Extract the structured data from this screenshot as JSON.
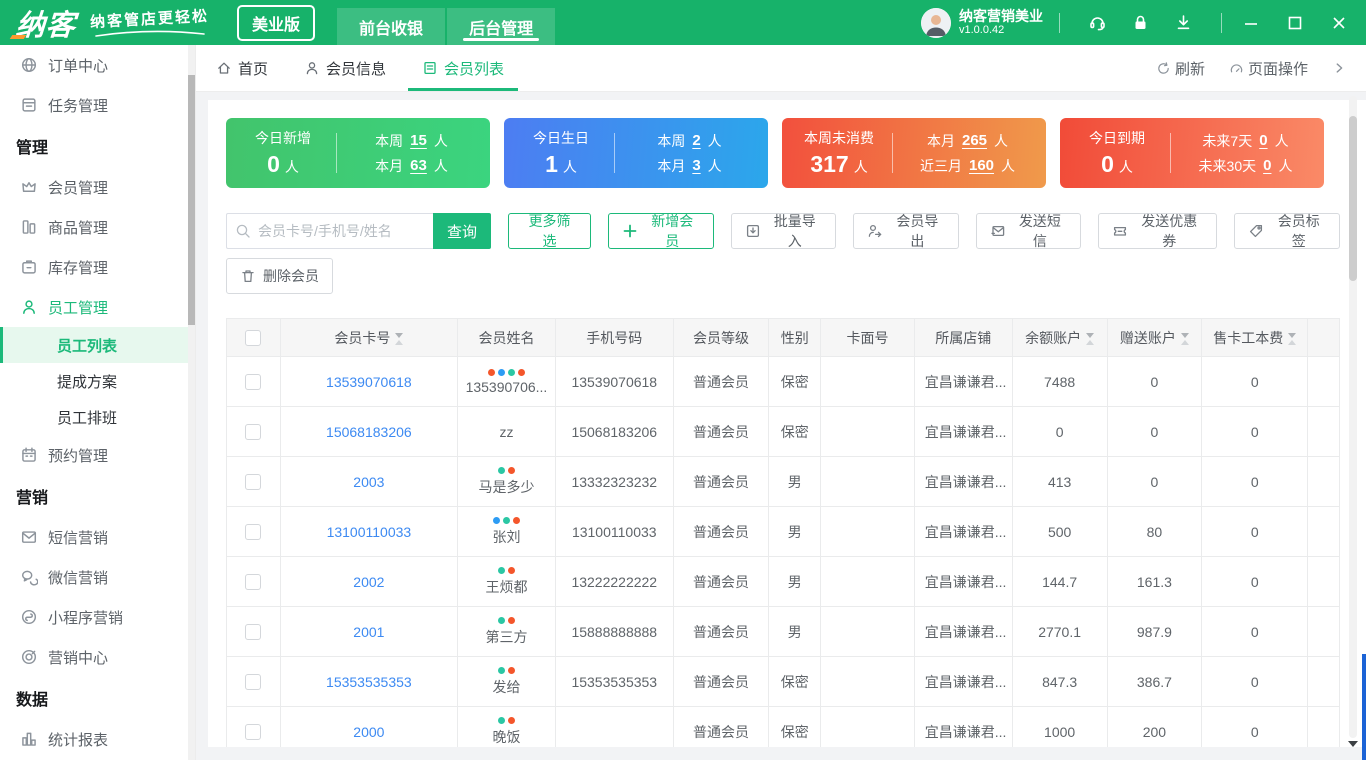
{
  "header": {
    "brand": "纳客",
    "tagline": "纳客管店更轻松",
    "edition": "美业版",
    "nav": [
      {
        "label": "前台收银",
        "active": false
      },
      {
        "label": "后台管理",
        "active": true
      }
    ],
    "user": {
      "name": "纳客营销美业",
      "version": "v1.0.0.42"
    },
    "action_icons": [
      "headset",
      "lock",
      "download"
    ],
    "window_controls": [
      "minimize",
      "maximize",
      "close"
    ]
  },
  "sidebar": {
    "items": [
      {
        "type": "item",
        "icon": "globe",
        "label": "订单中心",
        "chevron": "right"
      },
      {
        "type": "item",
        "icon": "task",
        "label": "任务管理"
      },
      {
        "type": "section",
        "label": "管理"
      },
      {
        "type": "item",
        "icon": "crown",
        "label": "会员管理",
        "chevron": "right"
      },
      {
        "type": "item",
        "icon": "goods",
        "label": "商品管理",
        "chevron": "right"
      },
      {
        "type": "item",
        "icon": "stock",
        "label": "库存管理",
        "chevron": "right"
      },
      {
        "type": "item",
        "icon": "person",
        "label": "员工管理",
        "chevron": "down",
        "active": true
      },
      {
        "type": "subitem",
        "label": "员工列表",
        "active": true
      },
      {
        "type": "subitem",
        "label": "提成方案"
      },
      {
        "type": "subitem",
        "label": "员工排班"
      },
      {
        "type": "item",
        "icon": "calendar",
        "label": "预约管理"
      },
      {
        "type": "section",
        "label": "营销"
      },
      {
        "type": "item",
        "icon": "mail",
        "label": "短信营销"
      },
      {
        "type": "item",
        "icon": "wechat",
        "label": "微信营销"
      },
      {
        "type": "item",
        "icon": "miniapp",
        "label": "小程序营销"
      },
      {
        "type": "item",
        "icon": "target",
        "label": "营销中心"
      },
      {
        "type": "section",
        "label": "数据"
      },
      {
        "type": "item",
        "icon": "chart",
        "label": "统计报表",
        "chevron": "right"
      }
    ]
  },
  "tabbar": {
    "tabs": [
      {
        "icon": "home",
        "label": "首页",
        "active": false
      },
      {
        "icon": "user",
        "label": "会员信息",
        "active": false
      },
      {
        "icon": "list",
        "label": "会员列表",
        "active": true
      }
    ],
    "refresh": "刷新",
    "page_ops": "页面操作"
  },
  "stat_cards": [
    {
      "title": "今日新增",
      "value": "0",
      "unit": "人",
      "colors": [
        "#42c46c",
        "#3bd47f"
      ],
      "rows": [
        {
          "label": "本周",
          "value": "15",
          "unit": "人"
        },
        {
          "label": "本月",
          "value": "63",
          "unit": "人"
        }
      ]
    },
    {
      "title": "今日生日",
      "value": "1",
      "unit": "人",
      "colors": [
        "#4d7df2",
        "#2ba7eb"
      ],
      "rows": [
        {
          "label": "本周",
          "value": "2",
          "unit": "人"
        },
        {
          "label": "本月",
          "value": "3",
          "unit": "人"
        }
      ]
    },
    {
      "title": "本周未消费",
      "value": "317",
      "unit": "人",
      "colors": [
        "#f2503d",
        "#f09a4b"
      ],
      "rows": [
        {
          "label": "本月",
          "value": "265",
          "unit": "人"
        },
        {
          "label": "近三月",
          "value": "160",
          "unit": "人"
        }
      ]
    },
    {
      "title": "今日到期",
      "value": "0",
      "unit": "人",
      "colors": [
        "#f14b38",
        "#fa8a67"
      ],
      "rows": [
        {
          "label": "未来7天",
          "value": "0",
          "unit": "人"
        },
        {
          "label": "未来30天",
          "value": "0",
          "unit": "人"
        }
      ]
    }
  ],
  "toolbar": {
    "search_placeholder": "会员卡号/手机号/姓名",
    "search_button": "查询",
    "buttons_row1": [
      {
        "label": "更多筛选",
        "style": "green"
      },
      {
        "label": "新增会员",
        "style": "green",
        "icon": "plus"
      },
      {
        "label": "批量导入",
        "style": "gray",
        "icon": "import"
      },
      {
        "label": "会员导出",
        "style": "gray",
        "icon": "user-export"
      },
      {
        "label": "发送短信",
        "style": "gray",
        "icon": "mail-send"
      },
      {
        "label": "发送优惠券",
        "style": "gray",
        "icon": "coupon"
      },
      {
        "label": "会员标签",
        "style": "gray",
        "icon": "tag"
      }
    ],
    "buttons_row2": [
      {
        "label": "删除会员",
        "style": "gray",
        "icon": "trash"
      }
    ]
  },
  "table": {
    "columns": [
      {
        "key": "select",
        "label": "",
        "type": "checkbox"
      },
      {
        "key": "card_no",
        "label": "会员卡号",
        "sortable": true
      },
      {
        "key": "name",
        "label": "会员姓名"
      },
      {
        "key": "phone",
        "label": "手机号码"
      },
      {
        "key": "level",
        "label": "会员等级"
      },
      {
        "key": "gender",
        "label": "性别"
      },
      {
        "key": "card_face",
        "label": "卡面号"
      },
      {
        "key": "store",
        "label": "所属店铺"
      },
      {
        "key": "balance",
        "label": "余额账户",
        "sortable": true
      },
      {
        "key": "gift",
        "label": "赠送账户",
        "sortable": true
      },
      {
        "key": "card_fee",
        "label": "售卡工本费",
        "sortable": true
      },
      {
        "key": "extra",
        "label": ""
      }
    ],
    "rows": [
      {
        "card_no": "13539070618",
        "dots": [
          "orange",
          "blue",
          "teal",
          "orange"
        ],
        "name": "135390706...",
        "phone": "13539070618",
        "level": "普通会员",
        "gender": "保密",
        "card_face": "",
        "store": "宜昌谦谦君...",
        "balance": "7488",
        "gift": "0",
        "card_fee": "0"
      },
      {
        "card_no": "15068183206",
        "dots": [],
        "name": "zz",
        "phone": "15068183206",
        "level": "普通会员",
        "gender": "保密",
        "card_face": "",
        "store": "宜昌谦谦君...",
        "balance": "0",
        "gift": "0",
        "card_fee": "0"
      },
      {
        "card_no": "2003",
        "dots": [
          "teal",
          "orange"
        ],
        "name": "马是多少",
        "phone": "13332323232",
        "level": "普通会员",
        "gender": "男",
        "card_face": "",
        "store": "宜昌谦谦君...",
        "balance": "413",
        "gift": "0",
        "card_fee": "0"
      },
      {
        "card_no": "13100110033",
        "dots": [
          "blue",
          "teal",
          "orange"
        ],
        "name": "张刘",
        "phone": "13100110033",
        "level": "普通会员",
        "gender": "男",
        "card_face": "",
        "store": "宜昌谦谦君...",
        "balance": "500",
        "gift": "80",
        "card_fee": "0"
      },
      {
        "card_no": "2002",
        "dots": [
          "teal",
          "orange"
        ],
        "name": "王烦都",
        "phone": "13222222222",
        "level": "普通会员",
        "gender": "男",
        "card_face": "",
        "store": "宜昌谦谦君...",
        "balance": "144.7",
        "gift": "161.3",
        "card_fee": "0"
      },
      {
        "card_no": "2001",
        "dots": [
          "teal",
          "orange"
        ],
        "name": "第三方",
        "phone": "15888888888",
        "level": "普通会员",
        "gender": "男",
        "card_face": "",
        "store": "宜昌谦谦君...",
        "balance": "2770.1",
        "gift": "987.9",
        "card_fee": "0"
      },
      {
        "card_no": "15353535353",
        "dots": [
          "teal",
          "orange"
        ],
        "name": "发给",
        "phone": "15353535353",
        "level": "普通会员",
        "gender": "保密",
        "card_face": "",
        "store": "宜昌谦谦君...",
        "balance": "847.3",
        "gift": "386.7",
        "card_fee": "0"
      },
      {
        "card_no": "2000",
        "dots": [
          "teal",
          "orange"
        ],
        "name": "晚饭",
        "phone": "",
        "level": "普通会员",
        "gender": "保密",
        "card_face": "",
        "store": "宜昌谦谦君...",
        "balance": "1000",
        "gift": "200",
        "card_fee": "0"
      }
    ]
  },
  "colors": {
    "primary": "#1cb97a",
    "topbar": "#17b26a",
    "link": "#3d8af2",
    "dot_teal": "#2bc7a4",
    "dot_orange": "#f4562b",
    "dot_blue": "#2d9cf4"
  }
}
